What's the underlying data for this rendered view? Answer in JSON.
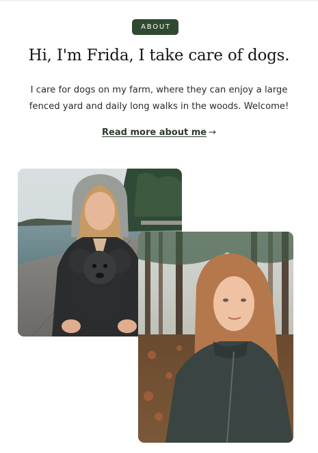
{
  "badge": "ABOUT",
  "title": "Hi, I'm Frida, I take care of dogs.",
  "intro_line1": "I care for dogs on my farm, where they can enjoy a large",
  "intro_line2": "fenced yard and daily long walks in the woods. Welcome!",
  "read_more": "Read more about me",
  "read_more_arrow": "→",
  "colors": {
    "accent": "#2f4a30",
    "text": "#161616"
  },
  "icons": {
    "read_more": "arrow-right-icon"
  }
}
